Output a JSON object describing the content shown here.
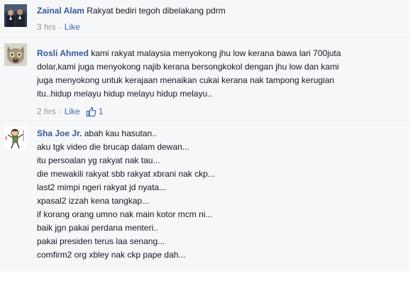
{
  "comments": [
    {
      "author": "Zainal Alam",
      "avatar": "men-in-suits-photo",
      "text": "Rakyat bediri tegoh dibelakang pdrm",
      "time": "3 hrs",
      "like_label": "Like"
    },
    {
      "author": "Rosli Ahmed",
      "avatar": "cat-photo",
      "lines": [
        "kami rakyat malaysia menyokong jhu low kerana bawa lari 700juta",
        "dolar,kami juga menyokong najib kerana bersongkokol dengan jhu low dan kami",
        "juga menyokong untuk kerajaan menaikan cukai kerana nak tampong kerugian",
        "itu..hidup melayu hidup melayu hidup melayu.."
      ],
      "time": "2 hrs",
      "like_label": "Like",
      "like_count": "1",
      "like_icon": "thumbs-up-icon"
    },
    {
      "author": "Sha Joe Jr.",
      "avatar": "cartoon-warrior-drawing",
      "lines": [
        "abah kau hasutan..",
        "aku tgk video die brucap dalam dewan...",
        "itu persoalan yg rakyat nak tau...",
        "die mewakili rakyat sbb rakyat xbrani nak ckp...",
        "last2 mimpi ngeri rakyat jd nyata...",
        "xpasal2 izzah kena tangkap...",
        "if korang orang umno nak main kotor mcm ni...",
        "baik jgn pakai perdana menteri..",
        "pakai presiden terus laa senang...",
        "comfirm2 org xbley nak ckp pape dah..."
      ]
    }
  ],
  "colors": {
    "author_link": "#365899",
    "like_link": "#4267b2",
    "meta_gray": "#90949c",
    "comment_bg": "#f6f7f9"
  }
}
